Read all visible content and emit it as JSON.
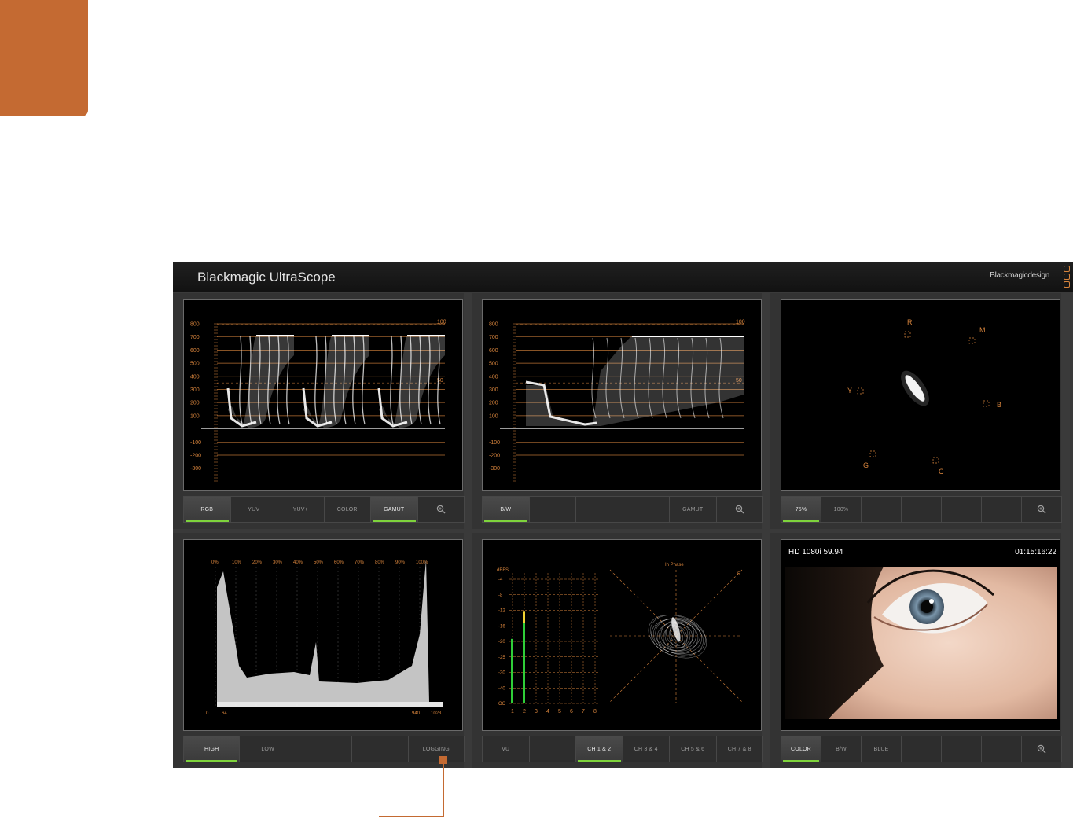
{
  "app": {
    "title": "Blackmagic UltraScope",
    "brand": "Blackmagicdesign"
  },
  "colors": {
    "accent": "#c46a32",
    "graticule": "#d8843c",
    "active_indicator": "#7ed33c",
    "panel_bg": "#333333"
  },
  "scopes": {
    "rgb_parade": {
      "y_labels": [
        "800",
        "700",
        "600",
        "500",
        "400",
        "300",
        "200",
        "100",
        "-100",
        "-200",
        "-300"
      ],
      "right_labels": [
        "100",
        "50"
      ],
      "buttons": [
        "RGB",
        "YUV",
        "YUV+",
        "COLOR",
        "GAMUT"
      ],
      "active": [
        "RGB",
        "GAMUT"
      ]
    },
    "waveform": {
      "y_labels": [
        "800",
        "700",
        "600",
        "500",
        "400",
        "300",
        "200",
        "100",
        "-100",
        "-200",
        "-300"
      ],
      "right_labels": [
        "100",
        "50"
      ],
      "buttons": [
        "B/W",
        "",
        "",
        "",
        "GAMUT"
      ],
      "active": [
        "B/W"
      ]
    },
    "vectorscope": {
      "targets": [
        "R",
        "M",
        "Y",
        "B",
        "G",
        "C"
      ],
      "buttons": [
        "75%",
        "100%",
        "",
        "",
        "",
        ""
      ],
      "active": [
        "75%"
      ]
    },
    "histogram": {
      "top_labels": [
        "0%",
        "10%",
        "20%",
        "30%",
        "40%",
        "50%",
        "60%",
        "70%",
        "80%",
        "90%",
        "100%"
      ],
      "bottom_labels": [
        "0",
        "64",
        "940",
        "1023"
      ],
      "buttons": [
        "HIGH",
        "LOW",
        "",
        "",
        "LOGGING"
      ],
      "active": [
        "HIGH"
      ]
    },
    "audio": {
      "db_label": "dBFS",
      "db_labels": [
        "-4",
        "-8",
        "-12",
        "-16",
        "-20",
        "-25",
        "-30",
        "-40",
        "OO"
      ],
      "channels": [
        "1",
        "2",
        "3",
        "4",
        "5",
        "6",
        "7",
        "8"
      ],
      "phase_label": "In Phase",
      "phase_l": "L",
      "phase_r": "R",
      "buttons": [
        "VU",
        "",
        "CH 1 & 2",
        "CH 3 & 4",
        "CH 5 & 6",
        "CH 7 & 8"
      ],
      "active": [
        "CH 1 & 2"
      ],
      "levels": [
        0.52,
        0.65
      ]
    },
    "picture": {
      "format": "HD 1080i 59.94",
      "timecode": "01:15:16:22",
      "buttons": [
        "COLOR",
        "B/W",
        "BLUE",
        "",
        "",
        ""
      ],
      "active": [
        "COLOR"
      ]
    }
  }
}
